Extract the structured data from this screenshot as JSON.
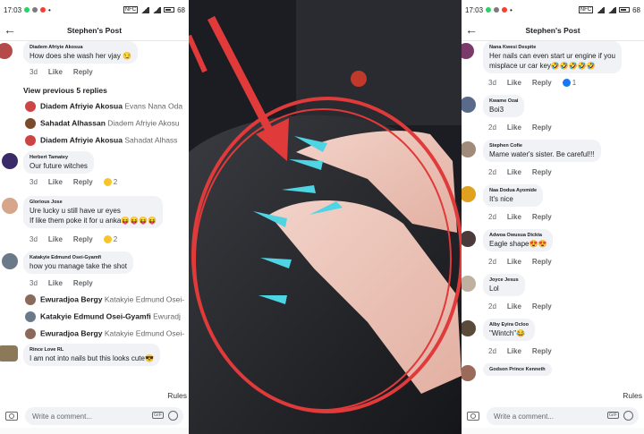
{
  "status_time": "17:03",
  "status_battery": "68",
  "post_title": "Stephen's Post",
  "action_like": "Like",
  "action_reply": "Reply",
  "rules_label": "Rules",
  "composer_placeholder": "Write a comment...",
  "gif_label": "GIF",
  "colors": {
    "accent": "#1877f2",
    "bubble": "#f0f2f5",
    "nail": "#4fd4e4",
    "circle": "#e03a3a"
  },
  "left": {
    "top_comment": {
      "name": "Diadem Afriyie Akosua",
      "text": "How does she wash her vjay 😏",
      "time": "3d"
    },
    "view_previous": "View previous 5 replies",
    "replies_top": [
      {
        "name": "Diadem Afriyie Akosua",
        "text": "Evans Nana Oda"
      },
      {
        "name": "Sahadat Alhassan",
        "text": "Diadem Afriyie Akosu"
      },
      {
        "name": "Diadem Afriyie Akosua",
        "text": "Sahadat Alhass"
      }
    ],
    "comments": [
      {
        "name": "Herbert Tamatey",
        "lines": [
          "Our future witches"
        ],
        "time": "3d",
        "react_count": "2"
      },
      {
        "name": "Glorious Jose",
        "lines": [
          "Ure lucky u still have ur eyes",
          "If like them poke it for u anka😝😝😝😝"
        ],
        "time": "3d",
        "react_count": "2"
      },
      {
        "name": "Katakyie Edmund Osei-Gyamfi",
        "lines": [
          "how you manage take the shot"
        ],
        "time": "3d",
        "react_count": ""
      }
    ],
    "replies_bottom": [
      {
        "name": "Ewuradjoa Bergy",
        "text": "Katakyie Edmund Osei-"
      },
      {
        "name": "Katakyie Edmund Osei-Gyamfi",
        "text": "Ewuradj"
      },
      {
        "name": "Ewuradjoa Bergy",
        "text": "Katakyie Edmund Osei-"
      }
    ],
    "last_comment": {
      "name": "Rince Love RL",
      "text": "I am not into nails but this looks cute😎"
    }
  },
  "right": {
    "comments": [
      {
        "name": "Nana Kwesi Despite",
        "lines": [
          "Her nails can even start ur engine if you",
          "misplace ur car key🤣🤣🤣🤣🤣"
        ],
        "time": "3d",
        "react_count": "1"
      },
      {
        "name": "Kwame Ozai",
        "lines": [
          "Boi3"
        ],
        "time": "2d",
        "react_count": ""
      },
      {
        "name": "Stephen Cofie",
        "lines": [
          "Mame water's sister. Be careful!!!"
        ],
        "time": "2d",
        "react_count": ""
      },
      {
        "name": "Naa Dodua Ayomide",
        "lines": [
          "It's nice"
        ],
        "time": "2d",
        "react_count": ""
      },
      {
        "name": "Adwoa Owusua Dickta",
        "lines": [
          "Eagle shape😍😍"
        ],
        "time": "2d",
        "react_count": ""
      },
      {
        "name": "Joyce Jesus",
        "lines": [
          "Lol"
        ],
        "time": "2d",
        "react_count": ""
      },
      {
        "name": "Alby Eyira Ocloo",
        "lines": [
          "\"Wintch\"😂"
        ],
        "time": "2d",
        "react_count": ""
      },
      {
        "name": "Godson Prince Kenneth",
        "lines": [
          ""
        ],
        "time": "",
        "react_count": ""
      }
    ]
  }
}
